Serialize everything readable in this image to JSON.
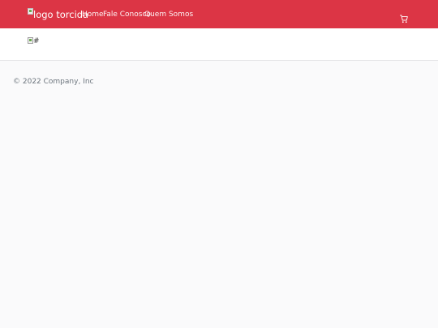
{
  "header": {
    "logo_alt_text": "logo torcida",
    "nav": [
      {
        "label": "Home"
      },
      {
        "label": "Fale Conosco"
      },
      {
        "label": "Quem Somos"
      }
    ],
    "cart_icon": "cart-icon",
    "background_color": "#dc3545"
  },
  "subbar": {
    "image_alt_text": "#"
  },
  "footer": {
    "copyright": "© 2022 Company, Inc"
  }
}
